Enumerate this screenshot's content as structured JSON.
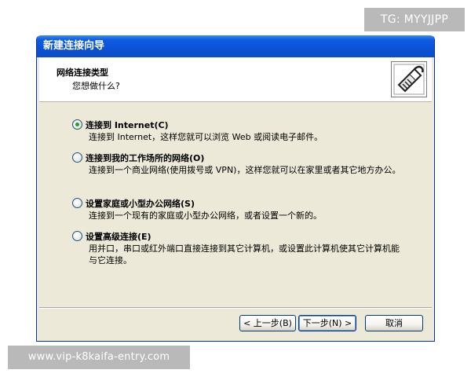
{
  "overlay": {
    "top_right_tag": "TG: MYYJJPP",
    "bottom_left_tag": "www.vip-k8kaifa-entry.com"
  },
  "window": {
    "title": "新建连接向导"
  },
  "header": {
    "title": "网络连接类型",
    "subtitle": "您想做什么?",
    "icon": "network-cable-icon"
  },
  "options": [
    {
      "label": "连接到 Internet(C)",
      "description": "连接到 Internet，这样您就可以浏览 Web 或阅读电子邮件。",
      "selected": true
    },
    {
      "label": "连接到我的工作场所的网络(O)",
      "description": "连接到一个商业网络(使用拨号或 VPN)，这样您就可以在家里或者其它地方办公。",
      "selected": false
    },
    {
      "label": "设置家庭或小型办公网络(S)",
      "description": "连接到一个现有的家庭或小型办公网络，或者设置一个新的。",
      "selected": false
    },
    {
      "label": "设置高级连接(E)",
      "description": "用并口，串口或红外端口直接连接到其它计算机，或设置此计算机使其它计算机能与它连接。",
      "selected": false
    }
  ],
  "buttons": {
    "back": "< 上一步(B)",
    "next": "下一步(N) >",
    "cancel": "取消"
  },
  "colors": {
    "titlebar": "#0a52d6",
    "dialog_bg": "#ece9d8",
    "radio_selected": "#2c9a28"
  }
}
